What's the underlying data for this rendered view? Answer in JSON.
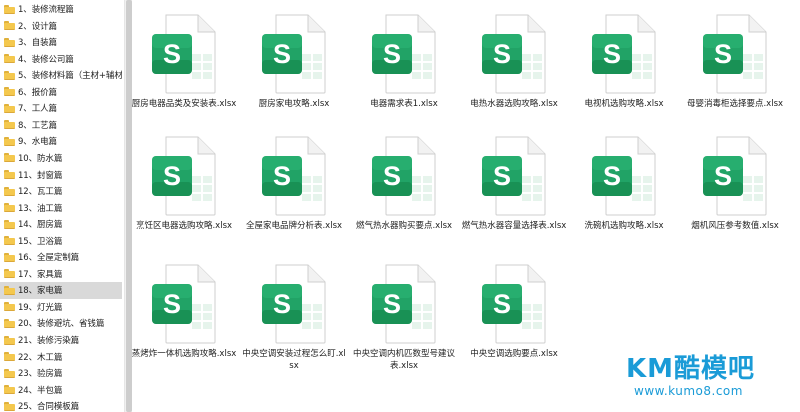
{
  "sidebar": {
    "items": [
      {
        "label": "1、装修流程篇"
      },
      {
        "label": "2、设计篇"
      },
      {
        "label": "3、自装篇"
      },
      {
        "label": "4、装修公司篇"
      },
      {
        "label": "5、装修材料篇（主材+辅材）"
      },
      {
        "label": "6、报价篇"
      },
      {
        "label": "7、工人篇"
      },
      {
        "label": "8、工艺篇"
      },
      {
        "label": "9、水电篇"
      },
      {
        "label": "10、防水篇"
      },
      {
        "label": "11、封窗篇"
      },
      {
        "label": "12、瓦工篇"
      },
      {
        "label": "13、油工篇"
      },
      {
        "label": "14、厨房篇"
      },
      {
        "label": "15、卫浴篇"
      },
      {
        "label": "16、全屋定制篇"
      },
      {
        "label": "17、家具篇"
      },
      {
        "label": "18、家电篇",
        "selected": true
      },
      {
        "label": "19、灯光篇"
      },
      {
        "label": "20、装修避坑、省钱篇"
      },
      {
        "label": "21、装修污染篇"
      },
      {
        "label": "22、木工篇"
      },
      {
        "label": "23、验房篇"
      },
      {
        "label": "24、半包篇"
      },
      {
        "label": "25、合同模板篇"
      }
    ]
  },
  "files": [
    {
      "name": "厨房电器品类及安装表.xlsx"
    },
    {
      "name": "厨房家电攻略.xlsx"
    },
    {
      "name": "电器需求表1.xlsx"
    },
    {
      "name": "电热水器选购攻略.xlsx"
    },
    {
      "name": "电视机选购攻略.xlsx"
    },
    {
      "name": "母婴消毒柜选择要点.xlsx"
    },
    {
      "name": "烹饪区电器选购攻略.xlsx"
    },
    {
      "name": "全屋家电品牌分析表.xlsx"
    },
    {
      "name": "燃气热水器购买要点.xlsx"
    },
    {
      "name": "燃气热水器容量选择表.xlsx"
    },
    {
      "name": "洗碗机选购攻略.xlsx"
    },
    {
      "name": "烟机风压参考数值.xlsx"
    },
    {
      "name": "蒸烤炸一体机选购攻略.xlsx"
    },
    {
      "name": "中央空调安装过程怎么盯.xlsx"
    },
    {
      "name": "中央空调内机匹数型号建议表.xlsx"
    },
    {
      "name": "中央空调选购要点.xlsx"
    }
  ],
  "icon": {
    "name": "excel-file-icon",
    "letter": "S",
    "accent": "#21a366",
    "dark": "#107c41",
    "light": "#33c481"
  },
  "watermark": {
    "logo": "KM酷模吧",
    "url": "www.kumo8.com"
  }
}
